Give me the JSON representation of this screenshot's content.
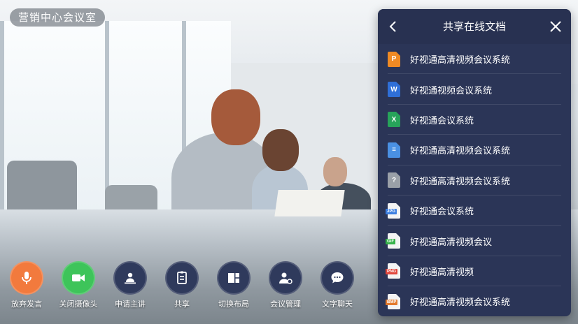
{
  "room": {
    "title": "营销中心会议室"
  },
  "toolbar": {
    "buttons": [
      {
        "label": "放弃发言",
        "icon": "microphone-icon",
        "color": "#f27a3d"
      },
      {
        "label": "关闭摄像头",
        "icon": "video-camera-icon",
        "color": "#3ec45a"
      },
      {
        "label": "申请主讲",
        "icon": "presenter-icon",
        "color": "#2f3a5c"
      },
      {
        "label": "共享",
        "icon": "share-icon",
        "color": "#2f3a5c"
      },
      {
        "label": "切换布局",
        "icon": "layout-icon",
        "color": "#2f3a5c"
      },
      {
        "label": "会议管理",
        "icon": "user-settings-icon",
        "color": "#2f3a5c"
      },
      {
        "label": "文字聊天",
        "icon": "chat-bubble-icon",
        "color": "#2f3a5c"
      }
    ]
  },
  "share_panel": {
    "title": "共享在线文档",
    "back_icon": "chevron-left-icon",
    "close_icon": "close-icon",
    "documents": [
      {
        "name": "好视通高清视频会议系统",
        "icon": "ppt-file-icon",
        "badge": "P",
        "color": "#f08a24"
      },
      {
        "name": "好视通视频会议系统",
        "icon": "word-file-icon",
        "badge": "W",
        "color": "#2f6fd8"
      },
      {
        "name": "好视通会议系统",
        "icon": "excel-file-icon",
        "badge": "X",
        "color": "#27a35a"
      },
      {
        "name": "好视通高清视频会议系统",
        "icon": "text-file-icon",
        "badge": "≡",
        "color": "#4a90e2"
      },
      {
        "name": "好视通高清视频会议系统",
        "icon": "unknown-file-icon",
        "badge": "?",
        "color": "#9aa0a8"
      },
      {
        "name": "好视通会议系统",
        "icon": "jpg-file-icon",
        "badge": "JPG",
        "color": "#3d7fe0"
      },
      {
        "name": "好视通高清视频会议",
        "icon": "gif-file-icon",
        "badge": "GIF",
        "color": "#36b24a"
      },
      {
        "name": "好视通高清视频",
        "icon": "png-file-icon",
        "badge": "PNG",
        "color": "#e0473d"
      },
      {
        "name": "好视通高清视频会议系统",
        "icon": "bmp-file-icon",
        "badge": "BMP",
        "color": "#e37a2d"
      }
    ]
  }
}
